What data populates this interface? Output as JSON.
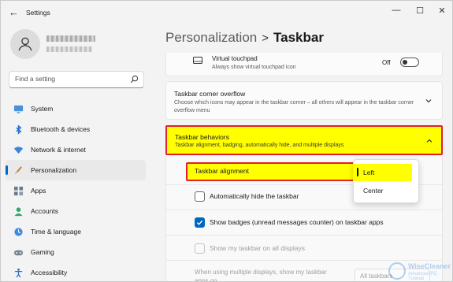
{
  "window": {
    "app_title": "Settings",
    "minimize": "—",
    "maximize": "☐",
    "close": "✕"
  },
  "sidebar": {
    "search_placeholder": "Find a setting",
    "items": [
      {
        "label": "System",
        "icon": "monitor-icon"
      },
      {
        "label": "Bluetooth & devices",
        "icon": "bluetooth-icon"
      },
      {
        "label": "Network & internet",
        "icon": "wifi-icon"
      },
      {
        "label": "Personalization",
        "icon": "brush-icon",
        "active": true
      },
      {
        "label": "Apps",
        "icon": "apps-icon"
      },
      {
        "label": "Accounts",
        "icon": "person-icon"
      },
      {
        "label": "Time & language",
        "icon": "globe-clock-icon"
      },
      {
        "label": "Gaming",
        "icon": "gamepad-icon"
      },
      {
        "label": "Accessibility",
        "icon": "accessibility-icon"
      }
    ]
  },
  "header": {
    "parent": "Personalization",
    "separator": ">",
    "current": "Taskbar"
  },
  "touchpad": {
    "title": "Virtual touchpad",
    "subtitle": "Always show virtual touchpad icon",
    "toggle_state": "Off"
  },
  "overflow": {
    "title": "Taskbar corner overflow",
    "subtitle": "Choose which icons may appear in the taskbar corner – all others will appear in the taskbar corner overflow menu"
  },
  "behaviors": {
    "title": "Taskbar behaviors",
    "subtitle": "Taskbar alignment, badging, automatically hide, and multiple displays",
    "alignment_label": "Taskbar alignment",
    "alignment_options": [
      "Left",
      "Center"
    ],
    "alignment_selected": "Left",
    "auto_hide": {
      "label": "Automatically hide the taskbar",
      "checked": false
    },
    "badges": {
      "label": "Show badges (unread messages counter) on taskbar apps",
      "checked": true
    },
    "all_displays": {
      "label": "Show my taskbar on all displays",
      "checked": false,
      "disabled": true
    },
    "multi_display_label": "When using multiple displays, show my taskbar apps on",
    "multi_display_value": "All taskbars"
  },
  "watermark": {
    "text": "WiseCleaner",
    "sub": "Advanced PC Tuneup"
  },
  "colors": {
    "accent": "#0067c0",
    "highlight": "#ffff00",
    "annotation_border": "#e0202a"
  }
}
